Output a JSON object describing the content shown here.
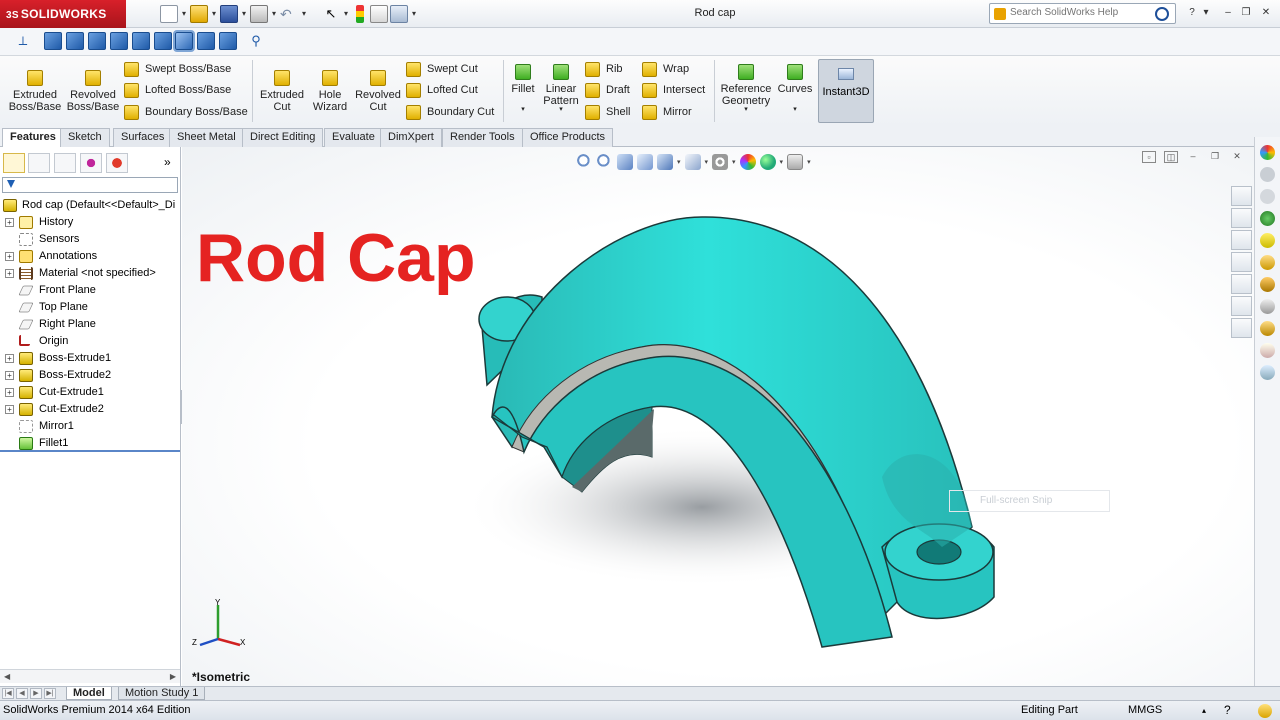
{
  "app": {
    "brand": "SOLIDWORKS",
    "document_title": "Rod cap",
    "help_search_placeholder": "Search SolidWorks Help"
  },
  "command_manager": {
    "extruded_boss": "Extruded Boss/Base",
    "revolved_boss": "Revolved Boss/Base",
    "swept_boss": "Swept Boss/Base",
    "lofted_boss": "Lofted Boss/Base",
    "boundary_boss": "Boundary Boss/Base",
    "extruded_cut": "Extruded Cut",
    "hole_wizard": "Hole Wizard",
    "revolved_cut": "Revolved Cut",
    "swept_cut": "Swept Cut",
    "lofted_cut": "Lofted Cut",
    "boundary_cut": "Boundary Cut",
    "fillet": "Fillet",
    "linear_pattern": "Linear Pattern",
    "rib": "Rib",
    "draft": "Draft",
    "shell": "Shell",
    "wrap": "Wrap",
    "intersect": "Intersect",
    "mirror": "Mirror",
    "reference_geometry": "Reference Geometry",
    "curves": "Curves",
    "instant3d": "Instant3D"
  },
  "tabs": [
    "Features",
    "Sketch",
    "Surfaces",
    "Sheet Metal",
    "Direct Editing",
    "Evaluate",
    "DimXpert",
    "Render Tools",
    "Office Products"
  ],
  "feature_tree": {
    "root": "Rod cap  (Default<<Default>_Di",
    "items": [
      {
        "label": "History",
        "icon": "history-icon",
        "expandable": true
      },
      {
        "label": "Sensors",
        "icon": "sensors-icon",
        "expandable": false
      },
      {
        "label": "Annotations",
        "icon": "annotations-icon",
        "expandable": true
      },
      {
        "label": "Material <not specified>",
        "icon": "material-icon",
        "expandable": true
      },
      {
        "label": "Front Plane",
        "icon": "plane-icon",
        "expandable": false
      },
      {
        "label": "Top Plane",
        "icon": "plane-icon",
        "expandable": false
      },
      {
        "label": "Right Plane",
        "icon": "plane-icon",
        "expandable": false
      },
      {
        "label": "Origin",
        "icon": "origin-icon",
        "expandable": false
      },
      {
        "label": "Boss-Extrude1",
        "icon": "extrude-icon",
        "expandable": true
      },
      {
        "label": "Boss-Extrude2",
        "icon": "extrude-icon",
        "expandable": true
      },
      {
        "label": "Cut-Extrude1",
        "icon": "cut-extrude-icon",
        "expandable": true
      },
      {
        "label": "Cut-Extrude2",
        "icon": "cut-extrude-icon",
        "expandable": true
      },
      {
        "label": "Mirror1",
        "icon": "mirror-icon",
        "expandable": false
      },
      {
        "label": "Fillet1",
        "icon": "fillet-icon",
        "expandable": false
      }
    ]
  },
  "graphics": {
    "overlay_title": "Rod Cap",
    "view_orientation": "*Isometric",
    "snip_hint": "Full-screen Snip",
    "model_color": "#27c4c0",
    "triad_labels": {
      "x": "X",
      "y": "Y",
      "z": "Z"
    }
  },
  "bottom_tabs": [
    "Model",
    "Motion Study 1"
  ],
  "status": {
    "edition": "SolidWorks Premium 2014 x64 Edition",
    "mode": "Editing Part",
    "units": "MMGS"
  },
  "colors": {
    "brand_red": "#c8182a",
    "title_red": "#e52321",
    "accent_blue": "#1f5aa8"
  }
}
